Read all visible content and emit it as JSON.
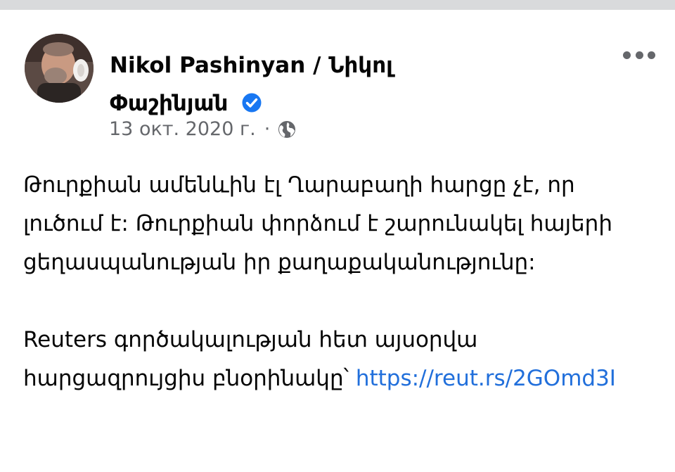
{
  "post": {
    "author": "Nikol Pashinyan / Նիկոլ Փաշինյան",
    "verified": true,
    "date": "13 окт. 2020 г.",
    "separator": "·",
    "audience_icon": "globe-icon",
    "more_icon": "more-options-icon",
    "paragraph1": "Թուրքիան ամենևին էլ Ղարաբաղի հարցը չէ, որ լուծում է: Թուրքիան փորձում է շարունակել հայերի ցեղասպանության իր քաղաքականությունը:",
    "paragraph2_text": "Reuters գործակալության հետ այսօրվա հարցազրույցիս բնօրինակը՝ ",
    "link": "https://reut.rs/2GOmd3I"
  },
  "colors": {
    "text": "#050505",
    "meta": "#65676b",
    "link": "#216fdb",
    "verified": "#1877f2",
    "top_strip": "#d9dadc"
  }
}
